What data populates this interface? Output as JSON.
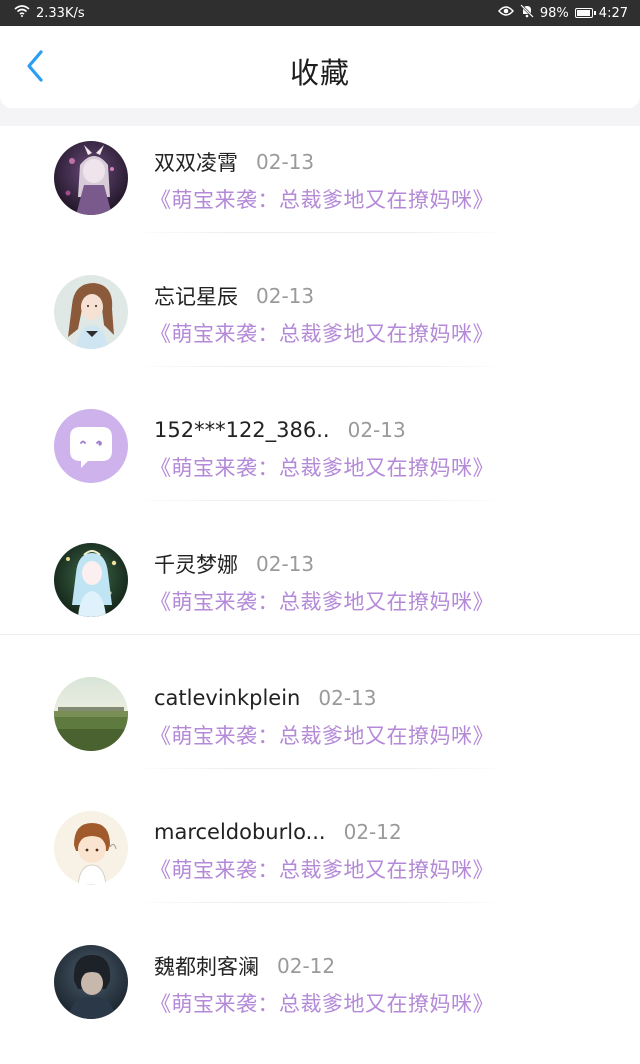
{
  "status_bar": {
    "net_speed": "2.33K/s",
    "battery": "98%",
    "battery_level": 0.98,
    "time": "4:27",
    "icons": [
      "wifi-icon",
      "eye-icon",
      "bell-muted-icon",
      "battery-icon"
    ]
  },
  "header": {
    "title": "收藏",
    "back_icon": "chevron-left-icon"
  },
  "colors": {
    "accent": "#2a9df4",
    "book_title": "#b48ad8",
    "status_bar_bg": "#2f2f2f"
  },
  "items": [
    {
      "name": "双双凌霄",
      "date": "02-13",
      "book": "《萌宝来袭：总裁爹地又在撩妈咪》",
      "avatar": "avatar-anime-girl-dark"
    },
    {
      "name": "忘记星辰",
      "date": "02-13",
      "book": "《萌宝来袭：总裁爹地又在撩妈咪》",
      "avatar": "avatar-girl-brown-hair"
    },
    {
      "name": "152***122_386..",
      "date": "02-13",
      "book": "《萌宝来袭：总裁爹地又在撩妈咪》",
      "avatar": "default-chat-avatar"
    },
    {
      "name": "千灵梦娜",
      "date": "02-13",
      "book": "《萌宝来袭：总裁爹地又在撩妈咪》",
      "avatar": "avatar-anime-girl-blue"
    },
    {
      "name": "catlevinkplein",
      "date": "02-13",
      "book": "《萌宝来袭：总裁爹地又在撩妈咪》",
      "avatar": "avatar-landscape"
    },
    {
      "name": "marceldoburlo...",
      "date": "02-12",
      "book": "《萌宝来袭：总裁爹地又在撩妈咪》",
      "avatar": "avatar-cartoon-boy"
    },
    {
      "name": "魏都刺客澜",
      "date": "02-12",
      "book": "《萌宝来袭：总裁爹地又在撩妈咪》",
      "avatar": "avatar-dark-figure"
    }
  ]
}
